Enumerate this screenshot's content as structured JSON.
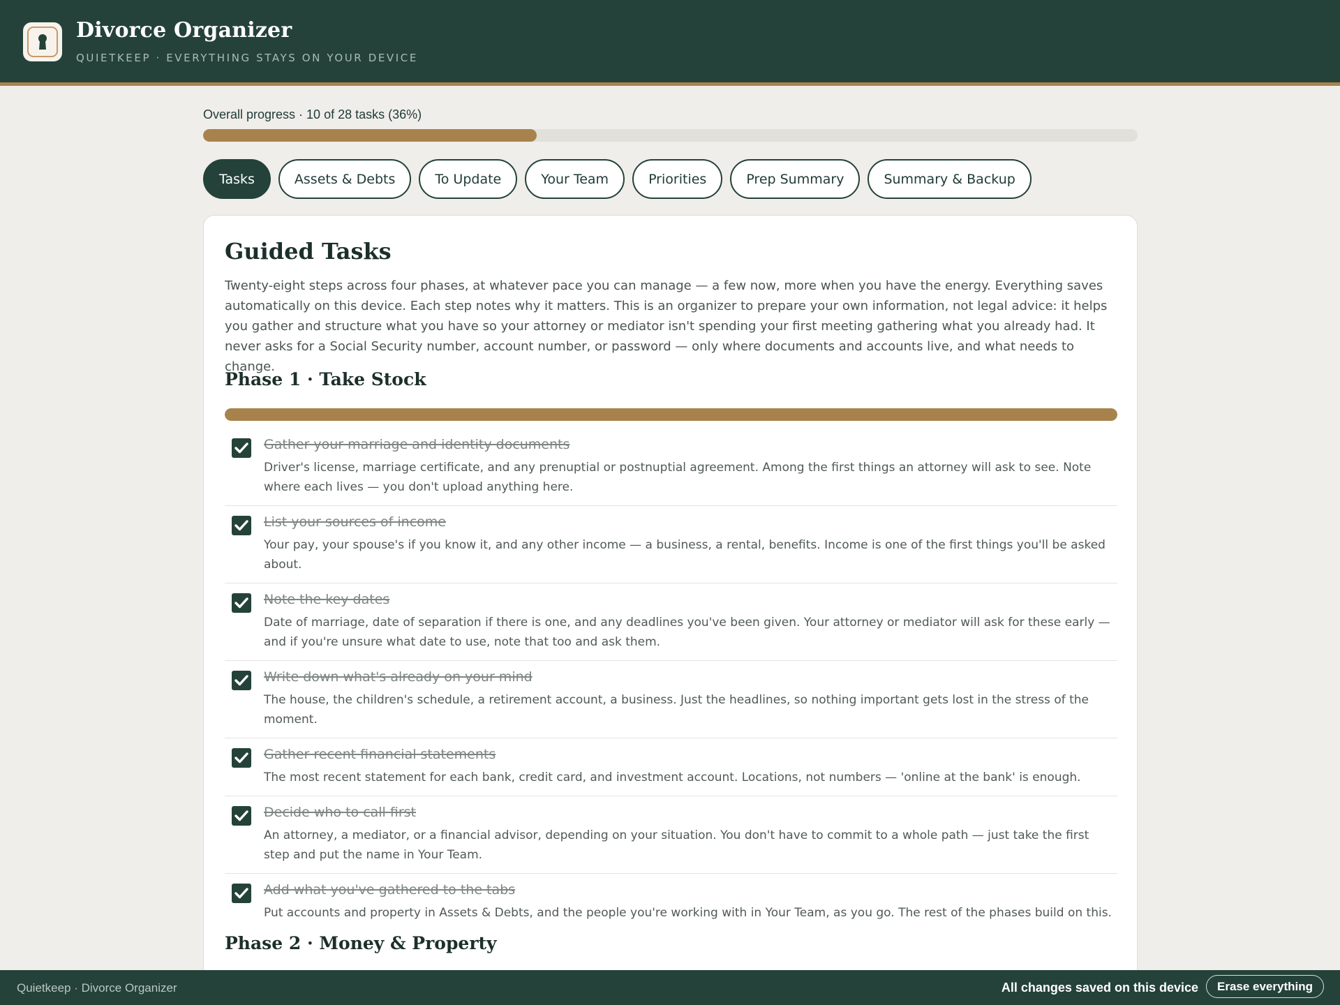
{
  "header": {
    "title": "Divorce Organizer",
    "subtitle": "QUIETKEEP · EVERYTHING STAYS ON YOUR DEVICE",
    "logo_icon": "keyhole-icon"
  },
  "progress": {
    "label": "Overall progress · 10 of 28 tasks (36%)",
    "completed": 10,
    "total": 28,
    "percent": 36
  },
  "tabs": [
    {
      "label": "Tasks",
      "active": true
    },
    {
      "label": "Assets & Debts",
      "active": false
    },
    {
      "label": "To Update",
      "active": false
    },
    {
      "label": "Your Team",
      "active": false
    },
    {
      "label": "Priorities",
      "active": false
    },
    {
      "label": "Prep Summary",
      "active": false
    },
    {
      "label": "Summary & Backup",
      "active": false
    }
  ],
  "main": {
    "title": "Guided Tasks",
    "intro": "Twenty-eight steps across four phases, at whatever pace you can manage — a few now, more when you have the energy. Everything saves automatically on this device. Each step notes why it matters. This is an organizer to prepare your own information, not legal advice: it helps you gather and structure what you have so your attorney or mediator isn't spending your first meeting gathering what you already had. It never asks for a Social Security number, account number, or password — only where documents and accounts live, and what needs to change.",
    "phases": [
      {
        "title": "Phase 1 · Take Stock",
        "progress_fraction": 1.0,
        "tasks": [
          {
            "title": "Gather your marriage and identity documents",
            "done": true,
            "description": "Driver's license, marriage certificate, and any prenuptial or postnuptial agreement. Among the first things an attorney will ask to see. Note where each lives — you don't upload anything here."
          },
          {
            "title": "List your sources of income",
            "done": true,
            "description": "Your pay, your spouse's if you know it, and any other income — a business, a rental, benefits. Income is one of the first things you'll be asked about."
          },
          {
            "title": "Note the key dates",
            "done": true,
            "description": "Date of marriage, date of separation if there is one, and any deadlines you've been given. Your attorney or mediator will ask for these early — and if you're unsure what date to use, note that too and ask them."
          },
          {
            "title": "Write down what's already on your mind",
            "done": true,
            "description": "The house, the children's schedule, a retirement account, a business. Just the headlines, so nothing important gets lost in the stress of the moment."
          },
          {
            "title": "Gather recent financial statements",
            "done": true,
            "description": "The most recent statement for each bank, credit card, and investment account. Locations, not numbers — 'online at the bank' is enough."
          },
          {
            "title": "Decide who to call first",
            "done": true,
            "description": "An attorney, a mediator, or a financial advisor, depending on your situation. You don't have to commit to a whole path — just take the first step and put the name in Your Team."
          },
          {
            "title": "Add what you've gathered to the tabs",
            "done": true,
            "description": "Put accounts and property in Assets & Debts, and the people you're working with in Your Team, as you go. The rest of the phases build on this."
          }
        ]
      },
      {
        "title": "Phase 2 · Money & Property"
      }
    ]
  },
  "footer": {
    "app_name": "Quietkeep · Divorce Organizer",
    "save_status": "All changes saved on this device",
    "erase_label": "Erase everything"
  },
  "colors": {
    "primary": "#244239",
    "accent": "#a8824c",
    "background": "#f0eeea"
  }
}
